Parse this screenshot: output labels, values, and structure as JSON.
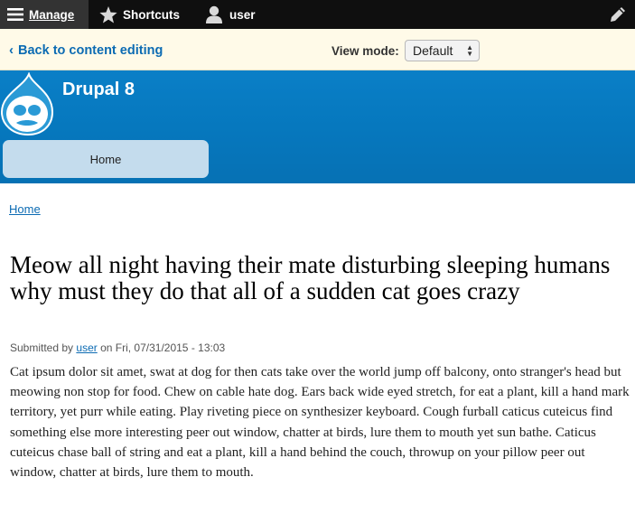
{
  "toolbar": {
    "manage_label": "Manage",
    "shortcuts_label": "Shortcuts",
    "user_label": "user",
    "icons": [
      "menu-icon",
      "star-icon",
      "user-icon",
      "pencil-icon"
    ]
  },
  "subbar": {
    "back_label": "Back to content editing",
    "view_mode_label": "View mode:",
    "view_mode_selected": "Default"
  },
  "header": {
    "site_name": "Drupal 8",
    "nav_home": "Home"
  },
  "breadcrumb": {
    "home": "Home"
  },
  "article": {
    "title": "Meow all night having their mate disturbing sleeping humans why must they do that all of a sudden cat goes crazy",
    "submitted_prefix": "Submitted by",
    "author": "user",
    "submitted_date": "on Fri, 07/31/2015 - 13:03",
    "body": "Cat ipsum dolor sit amet, swat at dog for then cats take over the world jump off balcony, onto stranger's head but meowing non stop for food. Chew on cable hate dog. Ears back wide eyed stretch, for eat a plant, kill a hand mark territory, yet purr while eating. Play riveting piece on synthesizer keyboard. Cough furball caticus cuteicus find something else more interesting peer out window, chatter at birds, lure them to mouth yet sun bathe. Caticus cuteicus chase ball of string and eat a plant, kill a hand behind the couch, throwup on your pillow peer out window, chatter at birds, lure them to mouth."
  },
  "colors": {
    "toolbar_bg": "#0f0f0f",
    "subbar_bg": "#fffae8",
    "header_blue": "#0678be",
    "link_blue": "#0c6bb3",
    "tab_bg": "#c4dced"
  }
}
